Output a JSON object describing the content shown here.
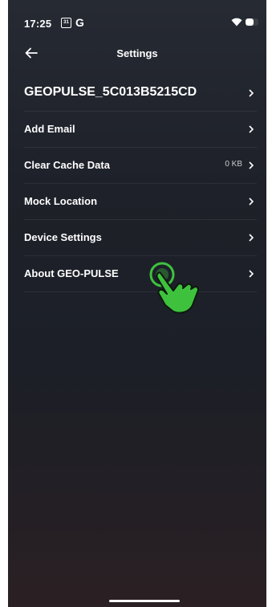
{
  "status_bar": {
    "time": "17:25",
    "calendar_day": "31",
    "g_label": "G"
  },
  "header": {
    "title": "Settings"
  },
  "settings": {
    "items": [
      {
        "label": "GEOPULSE_5C013B5215CD",
        "value": ""
      },
      {
        "label": "Add Email",
        "value": ""
      },
      {
        "label": "Clear Cache Data",
        "value": "0 KB"
      },
      {
        "label": "Mock Location",
        "value": ""
      },
      {
        "label": "Device Settings",
        "value": ""
      },
      {
        "label": "About GEO-PULSE",
        "value": ""
      }
    ]
  },
  "colors": {
    "background_top": "#262a33",
    "background_bottom": "#2b2023",
    "tap_indicator": "#3ec23e"
  },
  "icons": {
    "back": "arrow-left-icon",
    "chevron": "chevron-right-icon",
    "tap": "tap-hand-icon"
  }
}
